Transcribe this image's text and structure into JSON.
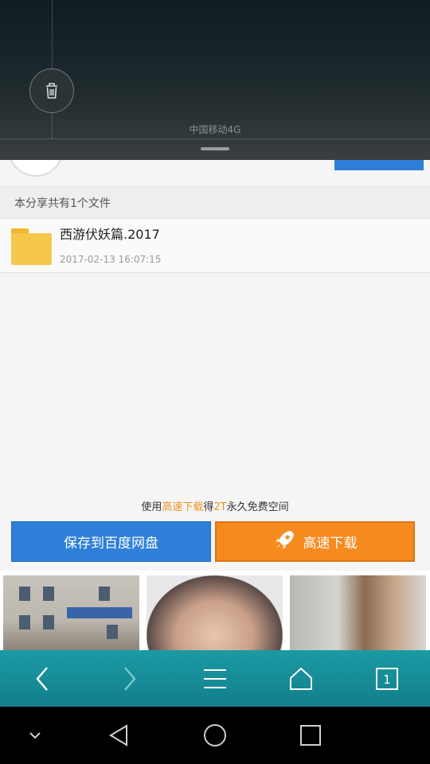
{
  "shade": {
    "carrier": "中国移动4G",
    "trash_icon": "trash-icon"
  },
  "share": {
    "info": "本分享共有1个文件"
  },
  "file": {
    "name": "西游伏妖篇.2017",
    "date": "2017-02-13 16:07:15",
    "icon": "folder-icon"
  },
  "promo": {
    "prefix": "使用",
    "highlight1": "高速下载",
    "middle": "得",
    "highlight2": "2T",
    "suffix": "永久免费空间"
  },
  "buttons": {
    "save": "保存到百度网盘",
    "fast_download": "高速下载"
  },
  "toolbar": {
    "icons": [
      "back-icon",
      "forward-icon",
      "menu-icon",
      "home-icon",
      "tabs-icon"
    ],
    "tab_count": "1"
  },
  "navbar": {
    "icons": [
      "collapse-icon",
      "back-triangle-icon",
      "home-circle-icon",
      "recents-square-icon"
    ]
  },
  "colors": {
    "accent_blue": "#2e7fd8",
    "accent_orange": "#f58a1f",
    "toolbar_teal": "#1a9ba5"
  }
}
